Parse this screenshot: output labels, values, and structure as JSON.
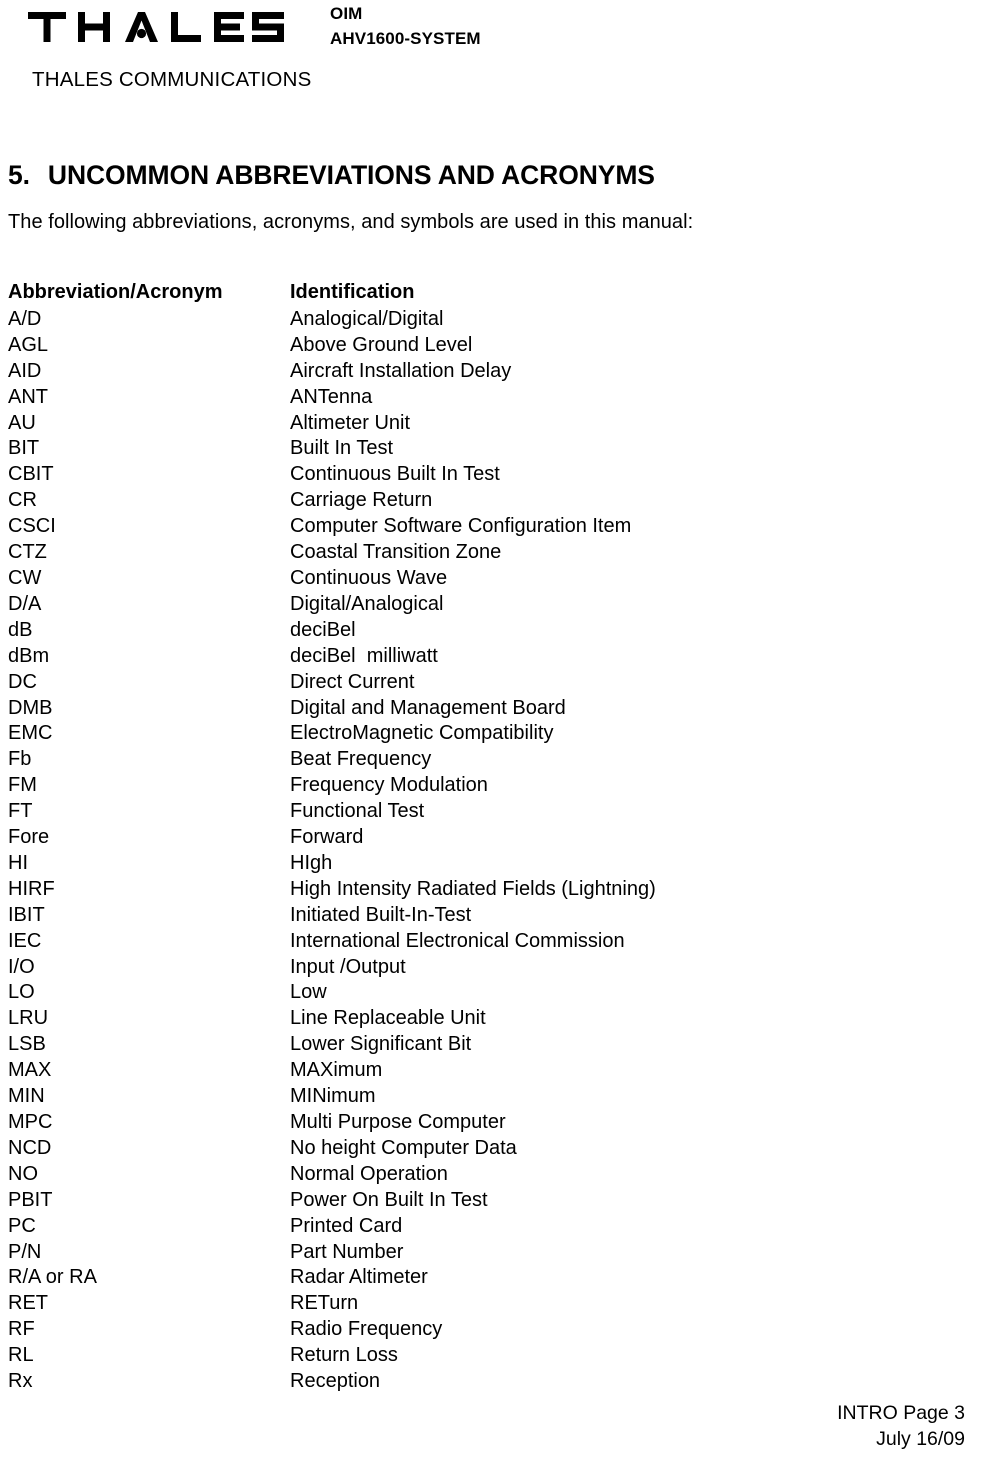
{
  "header": {
    "logo_text": "THALES",
    "logo_subtitle": "THALES COMMUNICATIONS",
    "doc_line1": "OIM",
    "doc_line2": "AHV1600-SYSTEM"
  },
  "section": {
    "number": "5.",
    "title": "UNCOMMON ABBREVIATIONS AND ACRONYMS",
    "intro": "The following abbreviations, acronyms, and symbols are used in this manual:"
  },
  "table": {
    "headers": [
      "Abbreviation/Acronym",
      "Identification"
    ],
    "rows": [
      [
        "A/D",
        "Analogical/Digital"
      ],
      [
        "AGL",
        "Above Ground Level"
      ],
      [
        "AID",
        "Aircraft Installation Delay"
      ],
      [
        "ANT",
        "ANTenna"
      ],
      [
        "AU",
        "Altimeter Unit"
      ],
      [
        "BIT",
        "Built In Test"
      ],
      [
        "CBIT",
        "Continuous Built In Test"
      ],
      [
        "CR",
        "Carriage Return"
      ],
      [
        "CSCI",
        "Computer Software Configuration Item"
      ],
      [
        "CTZ",
        "Coastal Transition Zone"
      ],
      [
        "CW",
        "Continuous Wave"
      ],
      [
        "D/A",
        "Digital/Analogical"
      ],
      [
        "dB",
        "deciBel"
      ],
      [
        "dBm",
        "deciBel  milliwatt"
      ],
      [
        "DC",
        "Direct Current"
      ],
      [
        "DMB",
        "Digital and Management Board"
      ],
      [
        "EMC",
        "ElectroMagnetic Compatibility"
      ],
      [
        "Fb",
        "Beat Frequency"
      ],
      [
        "FM",
        "Frequency Modulation"
      ],
      [
        "FT",
        "Functional Test"
      ],
      [
        "Fore",
        "Forward"
      ],
      [
        "HI",
        "HIgh"
      ],
      [
        "HIRF",
        "High Intensity Radiated Fields (Lightning)"
      ],
      [
        "IBIT",
        "Initiated Built-In-Test"
      ],
      [
        "IEC",
        "International Electronical Commission"
      ],
      [
        "I/O",
        "Input /Output"
      ],
      [
        "LO",
        "Low"
      ],
      [
        "LRU",
        "Line Replaceable Unit"
      ],
      [
        "LSB",
        "Lower Significant Bit"
      ],
      [
        "MAX",
        "MAXimum"
      ],
      [
        "MIN",
        "MINimum"
      ],
      [
        "MPC",
        "Multi Purpose Computer"
      ],
      [
        "NCD",
        "No height Computer Data"
      ],
      [
        "NO",
        "Normal Operation"
      ],
      [
        "PBIT",
        "Power On Built In Test"
      ],
      [
        "PC",
        "Printed Card"
      ],
      [
        "P/N",
        "Part Number"
      ],
      [
        "R/A or RA",
        "Radar Altimeter"
      ],
      [
        "RET",
        "RETurn"
      ],
      [
        "RF",
        "Radio Frequency"
      ],
      [
        "RL",
        "Return Loss"
      ],
      [
        "Rx",
        "Reception"
      ]
    ]
  },
  "footer": {
    "page_label": "INTRO Page 3",
    "date": "July 16/09"
  }
}
